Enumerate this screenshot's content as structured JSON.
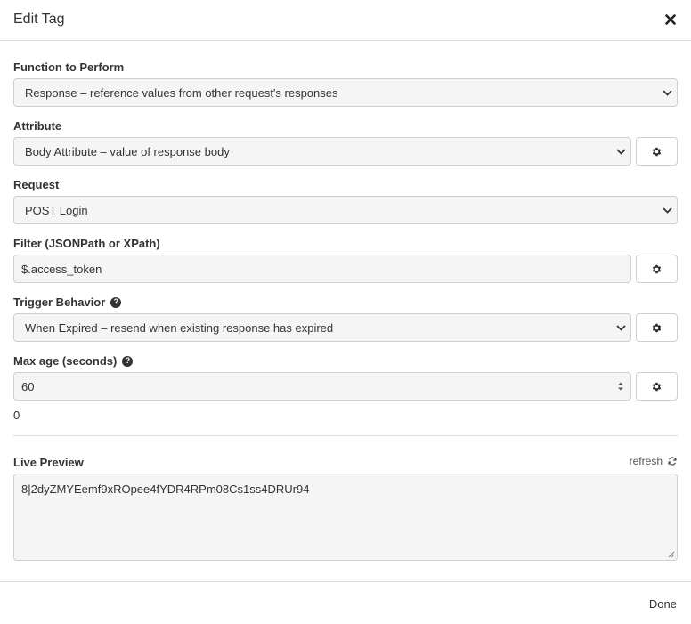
{
  "dialog": {
    "title": "Edit Tag",
    "close_icon": "close-icon"
  },
  "fields": {
    "function": {
      "label": "Function to Perform",
      "value": "Response – reference values from other request's responses"
    },
    "attribute": {
      "label": "Attribute",
      "value": "Body Attribute – value of response body"
    },
    "request": {
      "label": "Request",
      "value": "POST Login"
    },
    "filter": {
      "label": "Filter (JSONPath or XPath)",
      "value": "$.access_token"
    },
    "trigger": {
      "label": "Trigger Behavior",
      "value": "When Expired – resend when existing response has expired"
    },
    "max_age": {
      "label": "Max age (seconds)",
      "value": "60",
      "below_value": "0"
    }
  },
  "preview": {
    "label": "Live Preview",
    "refresh_label": "refresh",
    "value": "8|2dyZMYEemf9xROpee4fYDR4RPm08Cs1ss4DRUr94"
  },
  "footer": {
    "done_label": "Done"
  },
  "colors": {
    "input_bg": "#f5f5f5",
    "border": "#cfcfcf",
    "text": "#333333"
  }
}
